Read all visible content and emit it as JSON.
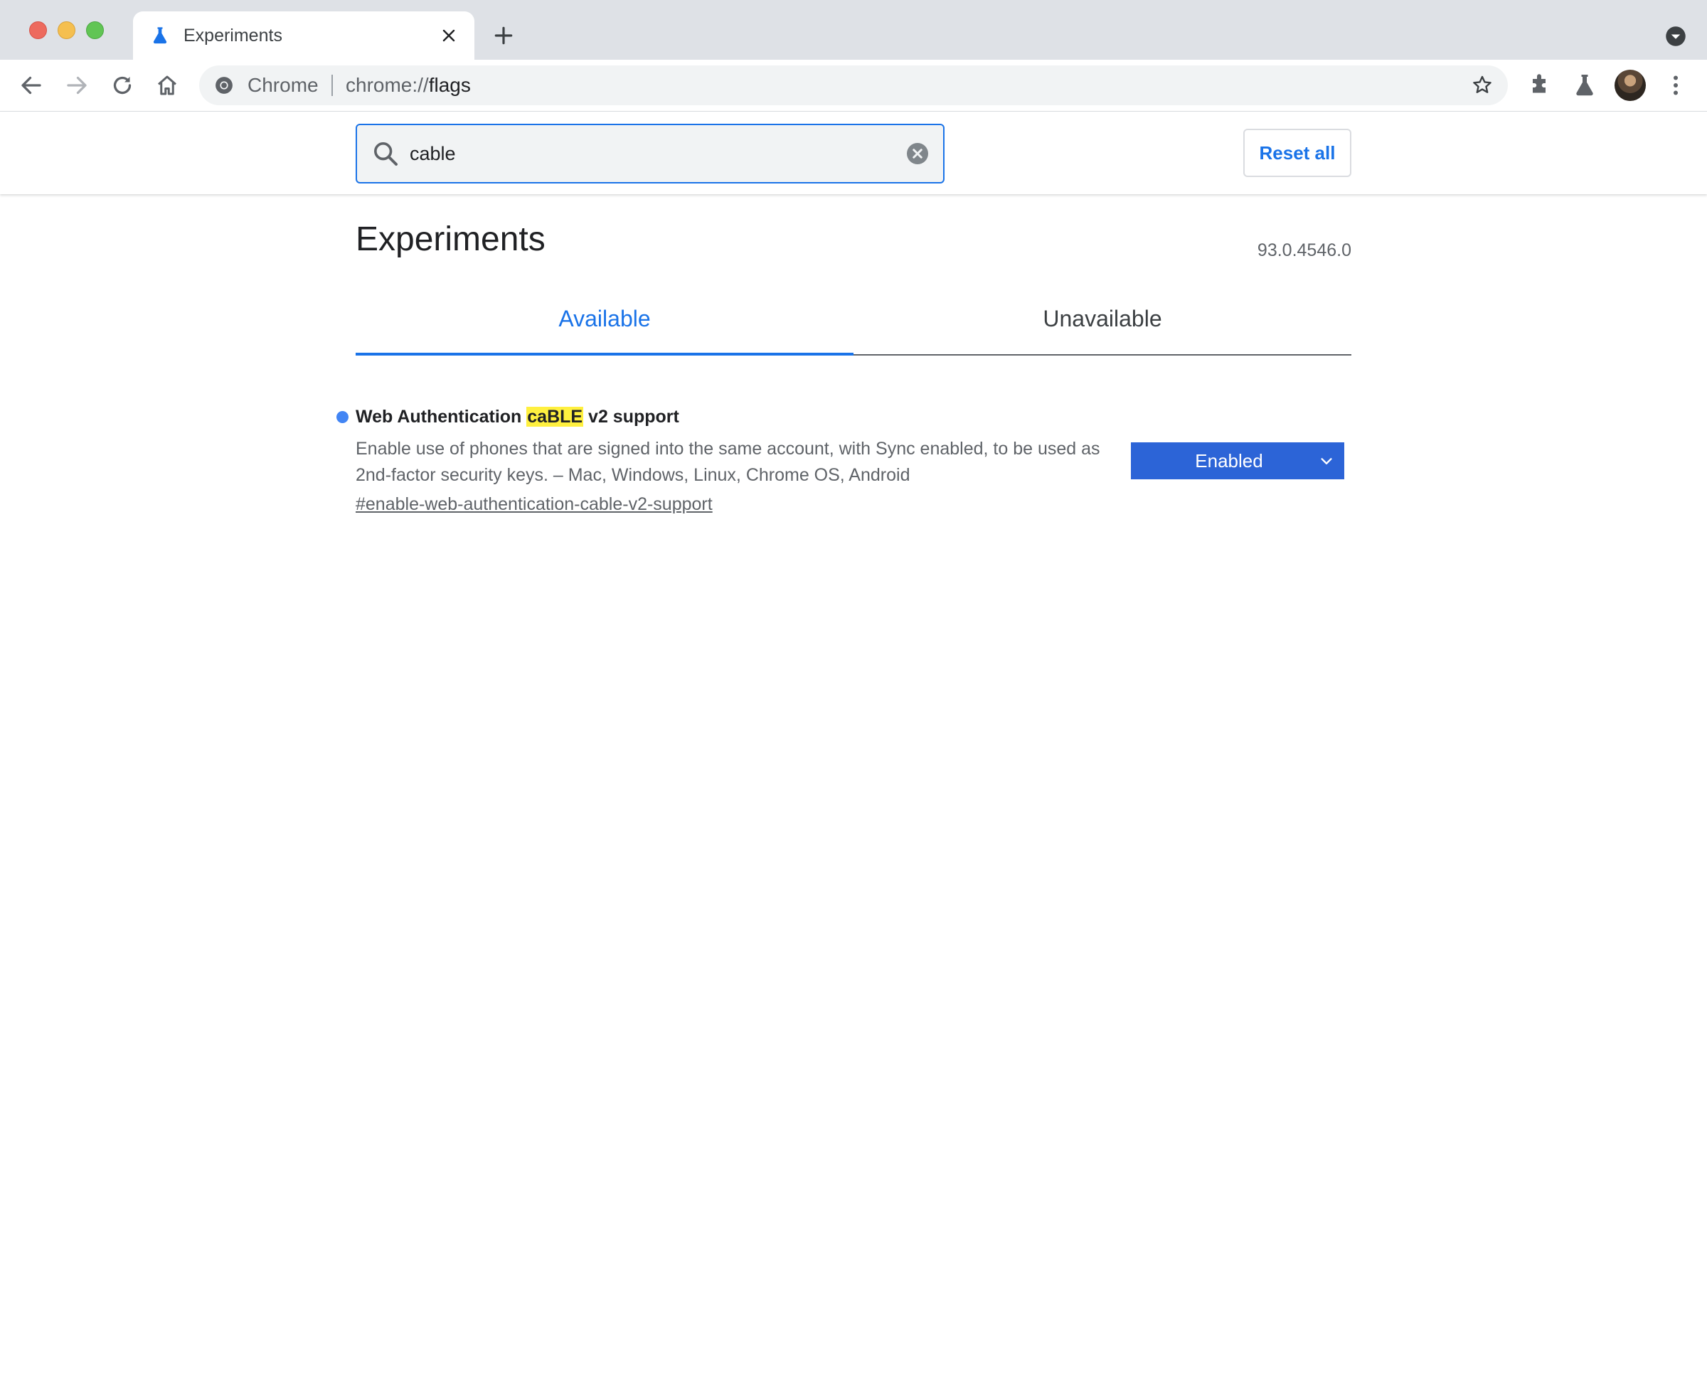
{
  "browser": {
    "tab_title": "Experiments",
    "omnibox_chip": "Chrome",
    "omnibox_url_scheme": "chrome://",
    "omnibox_url_host": "flags",
    "icons": {
      "tab_favicon": "flask-icon",
      "back": "back-arrow-icon",
      "forward": "forward-arrow-icon",
      "reload": "reload-icon",
      "home": "home-icon",
      "bookmark": "star-icon",
      "extensions": "puzzle-piece-icon",
      "labs": "flask-icon",
      "menu": "kebab-menu-icon"
    }
  },
  "flags_header": {
    "search_value": "cable",
    "reset_label": "Reset all"
  },
  "main": {
    "title": "Experiments",
    "version": "93.0.4546.0",
    "tabs": [
      {
        "label": "Available",
        "selected": true
      },
      {
        "label": "Unavailable",
        "selected": false
      }
    ]
  },
  "experiment": {
    "title_before": "Web Authentication ",
    "title_match": "caBLE",
    "title_after": " v2 support",
    "description": "Enable use of phones that are signed into the same account, with Sync enabled, to be used as 2nd-factor security keys. – Mac, Windows, Linux, Chrome OS, Android",
    "permalink": "#enable-web-authentication-cable-v2-support",
    "state": "Enabled",
    "state_color": "#2c64d7",
    "modified_dot_color": "#4285f4"
  }
}
